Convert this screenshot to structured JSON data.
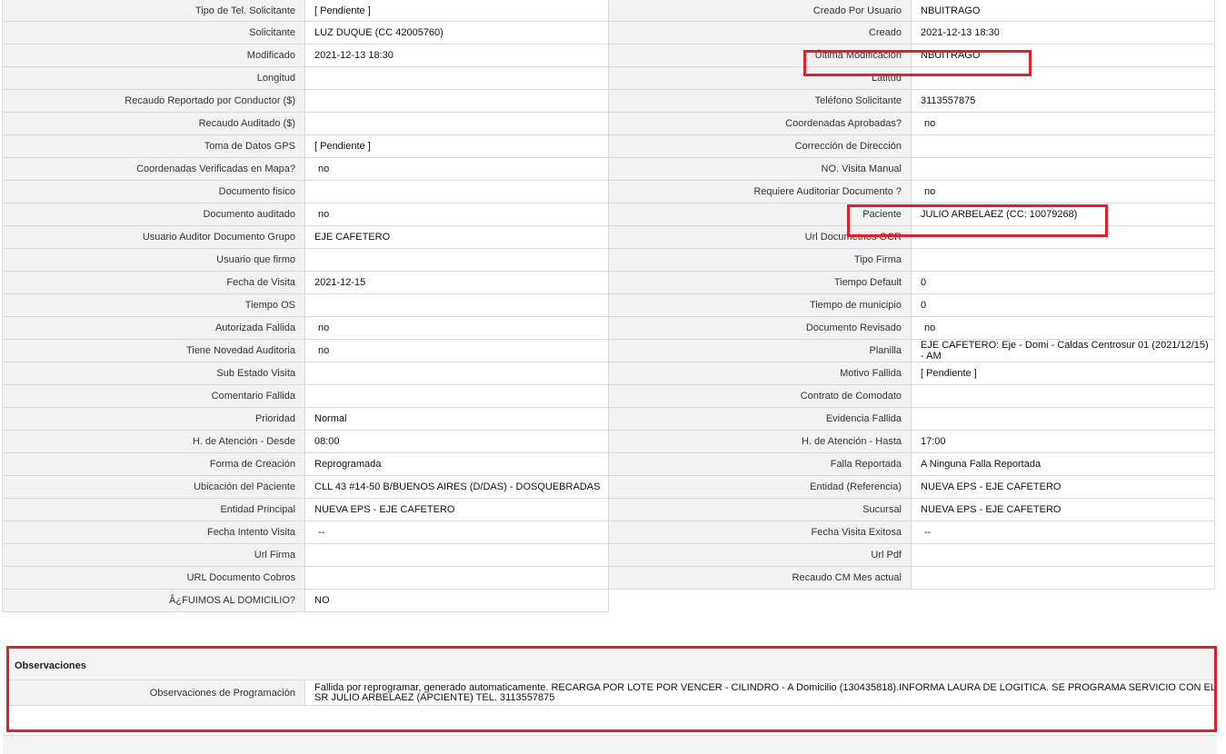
{
  "left_fields": [
    {
      "label": "Tipo de Tel. Solicitante",
      "value": "[ Pendiente ]"
    },
    {
      "label": "Solicitante",
      "value": "LUZ DUQUE (CC 42005760)"
    },
    {
      "label": "Modificado",
      "value": "2021-12-13 18:30"
    },
    {
      "label": "Longitud",
      "value": ""
    },
    {
      "label": "Recaudo Reportado por Conductor ($)",
      "value": ""
    },
    {
      "label": "Recaudo Auditado ($)",
      "value": ""
    },
    {
      "label": "Toma de Datos GPS",
      "value": "[ Pendiente ]"
    },
    {
      "label": "Coordenadas Verificadas en Mapa?",
      "value": "no"
    },
    {
      "label": "Documento fisico",
      "value": ""
    },
    {
      "label": "Documento auditado",
      "value": "no"
    },
    {
      "label": "Usuario Auditor Documento Grupo",
      "value": "EJE CAFETERO"
    },
    {
      "label": "Usuario que firmo",
      "value": ""
    },
    {
      "label": "Fecha de Visita",
      "value": "2021-12-15"
    },
    {
      "label": "Tiempo OS",
      "value": ""
    },
    {
      "label": "Autorizada Fallida",
      "value": "no"
    },
    {
      "label": "Tiene Novedad Auditoria",
      "value": "no"
    },
    {
      "label": "Sub Estado Visita",
      "value": ""
    },
    {
      "label": "Comentario Fallida",
      "value": ""
    },
    {
      "label": "Prioridad",
      "value": "Normal"
    },
    {
      "label": "H. de Atención - Desde",
      "value": "08:00"
    },
    {
      "label": "Forma de Creación",
      "value": "Reprogramada"
    },
    {
      "label": "Ubicación del Paciente",
      "value": "CLL 43 #14-50 B/BUENOS AIRES (D/DAS) - DOSQUEBRADAS"
    },
    {
      "label": "Entidad Principal",
      "value": "NUEVA EPS - EJE CAFETERO"
    },
    {
      "label": "Fecha Intento Visita",
      "value": "--"
    },
    {
      "label": "Url Firma",
      "value": ""
    },
    {
      "label": "URL Documento Cobros",
      "value": ""
    },
    {
      "label": "Â¿FUIMOS AL DOMICILIO?",
      "value": "NO"
    }
  ],
  "right_fields": [
    {
      "label": "Creado Por Usuario",
      "value": "NBUITRAGO"
    },
    {
      "label": "Creado",
      "value": "2021-12-13 18:30"
    },
    {
      "label": "Última Modificación",
      "value": "NBUITRAGO"
    },
    {
      "label": "Latitud",
      "value": ""
    },
    {
      "label": "Teléfono Solicitante",
      "value": "3113557875"
    },
    {
      "label": "Coordenadas Aprobadas?",
      "value": "no"
    },
    {
      "label": "Corrección de Dirección",
      "value": ""
    },
    {
      "label": "NO. Visita Manual",
      "value": ""
    },
    {
      "label": "Requiere Auditoriar Documento ?",
      "value": "no"
    },
    {
      "label": "Paciente",
      "value": "JULIO ARBELAEZ (CC: 10079268)"
    },
    {
      "label": "Url Documetnos OCR",
      "value": ""
    },
    {
      "label": "Tipo Firma",
      "value": ""
    },
    {
      "label": "Tiempo Default",
      "value": "0"
    },
    {
      "label": "Tiempo de municipio",
      "value": "0"
    },
    {
      "label": "Documento Revisado",
      "value": "no"
    },
    {
      "label": "Planilla",
      "value": "EJE CAFETERO: Eje - Domi - Caldas Centrosur 01 (2021/12/15) - AM"
    },
    {
      "label": "Motivo Fallida",
      "value": "[ Pendiente ]"
    },
    {
      "label": "Contrato de Comodato",
      "value": ""
    },
    {
      "label": "Evidencia Fallida",
      "value": ""
    },
    {
      "label": "H. de Atención - Hasta",
      "value": "17:00"
    },
    {
      "label": "Falla Reportada",
      "value": "A Ninguna Falla Reportada"
    },
    {
      "label": "Entidad (Referencia)",
      "value": "NUEVA EPS - EJE CAFETERO"
    },
    {
      "label": "Sucursal",
      "value": "NUEVA EPS - EJE CAFETERO"
    },
    {
      "label": "Fecha Visita Exitosa",
      "value": "--"
    },
    {
      "label": "Url Pdf",
      "value": ""
    },
    {
      "label": "Recaudo CM Mes actual",
      "value": ""
    }
  ],
  "observaciones": {
    "title": "Observaciones",
    "label": "Observaciones de Programación",
    "value": "Fallida por reprogramar, generado automaticamente. RECARGA POR LOTE POR VENCER - CILINDRO - A Domicilio (130435818).INFORMA LAURA DE LOGITICA. SE PROGRAMA SERVICIO CON EL SR JULIO ARBELAEZ (APCIENTE) TEL. 3113557875"
  },
  "colors": {
    "highlight": "#e0202a",
    "label_bg": "#f2f2f2",
    "border": "#dcdcdc"
  }
}
